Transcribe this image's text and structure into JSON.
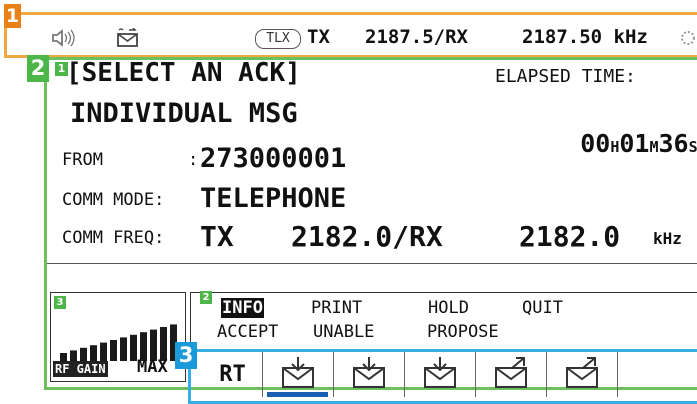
{
  "callouts": {
    "status_bar": "1",
    "main_display": "2",
    "main_sub1": "1",
    "main_sub2": "2",
    "gain_panel": "3",
    "toolbar": "3"
  },
  "status_bar": {
    "speaker_icon": "speaker-icon",
    "mail_icon": "envelope-icon",
    "mode_badge": "TLX",
    "tx_label": "TX",
    "tx_freq": "2187.5/RX",
    "rx_freq": "2187.50 kHz"
  },
  "message": {
    "title": "[SELECT AN ACK]",
    "subtitle": "INDIVIDUAL MSG",
    "elapsed_label": "ELAPSED TIME:",
    "elapsed": {
      "hours": "00",
      "h_unit": "H",
      "minutes": "01",
      "m_unit": "M",
      "seconds": "36",
      "s_unit": "S"
    },
    "from_label": "FROM",
    "from_colon": ":",
    "from_value": "273000001",
    "comm_mode_label": "COMM MODE:",
    "comm_mode_value": "TELEPHONE",
    "comm_freq_label": "COMM FREQ:",
    "comm_freq_tx": "TX",
    "comm_freq_value": "2182.0/RX",
    "comm_freq_rx": "2182.0",
    "comm_freq_unit": "kHz"
  },
  "menu": {
    "items_row1": [
      "INFO",
      "PRINT",
      "HOLD",
      "QUIT"
    ],
    "items_row2": [
      "ACCEPT",
      "UNABLE",
      "PROPOSE"
    ],
    "selected": "INFO"
  },
  "gain": {
    "label": "RF GAIN",
    "level_label": "MAX",
    "level_fraction": 1.0
  },
  "toolbar": {
    "rt_label": "RT",
    "icons": [
      "envelope-in-icon",
      "envelope-in-icon",
      "envelope-in-icon",
      "envelope-out-icon",
      "envelope-out-icon"
    ],
    "active_index": 0
  },
  "colors": {
    "orange_accent": "#e8811a",
    "green_accent": "#4cb648",
    "blue_accent": "#1a9ad8",
    "active_underline": "#1a5fb4"
  }
}
